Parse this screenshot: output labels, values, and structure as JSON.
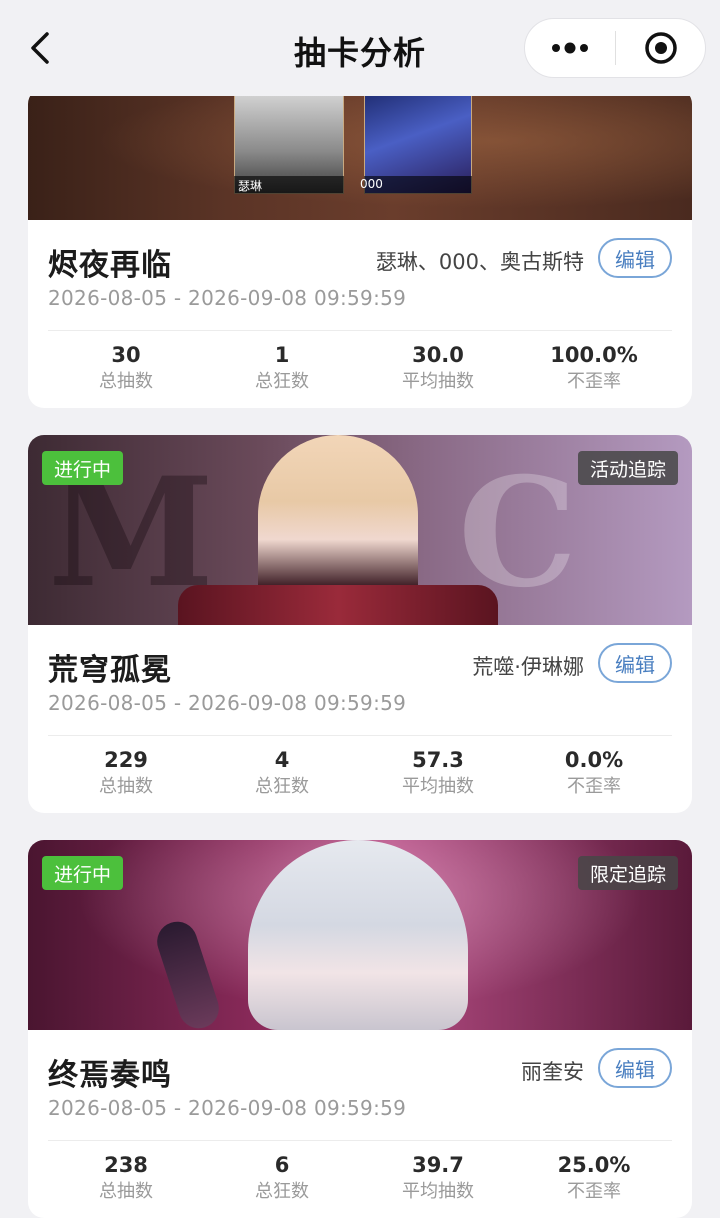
{
  "nav": {
    "title": "抽卡分析"
  },
  "cards": [
    {
      "title": "烬夜再临",
      "characters": "瑟琳、000、奥古斯特",
      "edit_label": "编辑",
      "date_range": "2026-08-05 - 2026-09-08 09:59:59",
      "banner_captions": [
        "瑟琳",
        "000"
      ],
      "stats": [
        {
          "value": "30",
          "label": "总抽数"
        },
        {
          "value": "1",
          "label": "总狂数"
        },
        {
          "value": "30.0",
          "label": "平均抽数"
        },
        {
          "value": "100.0%",
          "label": "不歪率"
        }
      ]
    },
    {
      "title": "荒穹孤冕",
      "characters": "荒噬·伊琳娜",
      "edit_label": "编辑",
      "status": "进行中",
      "tracking": "活动追踪",
      "date_range": "2026-08-05 - 2026-09-08 09:59:59",
      "stats": [
        {
          "value": "229",
          "label": "总抽数"
        },
        {
          "value": "4",
          "label": "总狂数"
        },
        {
          "value": "57.3",
          "label": "平均抽数"
        },
        {
          "value": "0.0%",
          "label": "不歪率"
        }
      ]
    },
    {
      "title": "终焉奏鸣",
      "characters": "丽奎安",
      "edit_label": "编辑",
      "status": "进行中",
      "tracking": "限定追踪",
      "date_range": "2026-08-05 - 2026-09-08 09:59:59",
      "stats": [
        {
          "value": "238",
          "label": "总抽数"
        },
        {
          "value": "6",
          "label": "总狂数"
        },
        {
          "value": "39.7",
          "label": "平均抽数"
        },
        {
          "value": "25.0%",
          "label": "不歪率"
        }
      ]
    }
  ]
}
